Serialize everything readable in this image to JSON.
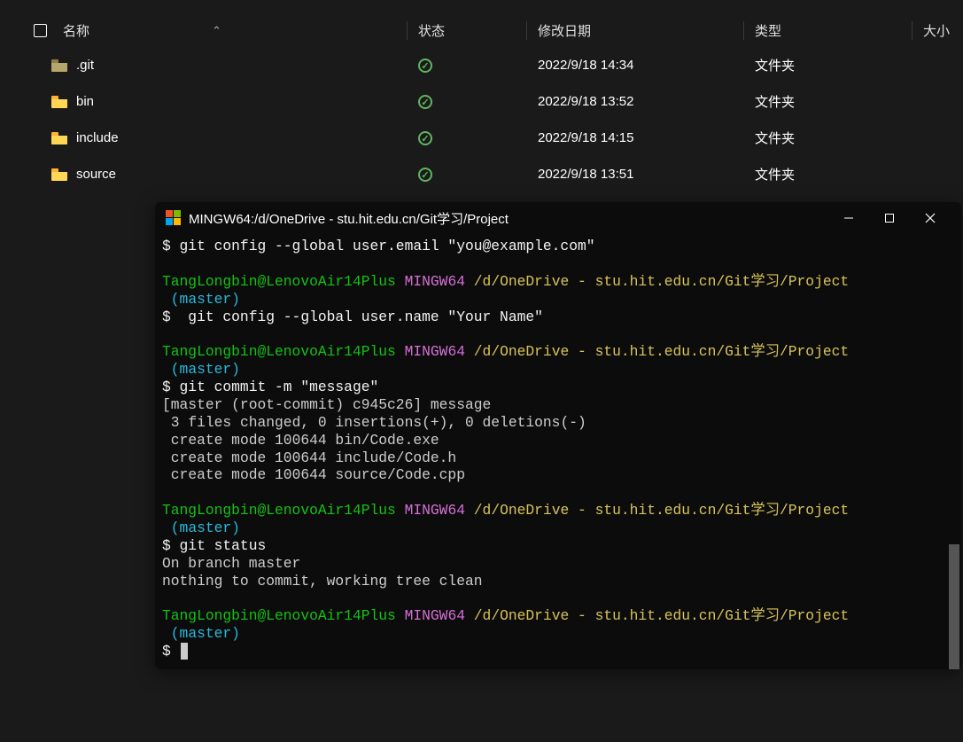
{
  "fileExplorer": {
    "headers": {
      "name": "名称",
      "status": "状态",
      "date": "修改日期",
      "type": "类型",
      "size": "大小"
    },
    "rows": [
      {
        "name": ".git",
        "folderClass": "dark",
        "date": "2022/9/18 14:34",
        "type": "文件夹",
        "hasStatus": true
      },
      {
        "name": "bin",
        "folderClass": "yellow",
        "date": "2022/9/18 13:52",
        "type": "文件夹",
        "hasStatus": true
      },
      {
        "name": "include",
        "folderClass": "yellow",
        "date": "2022/9/18 14:15",
        "type": "文件夹",
        "hasStatus": true
      },
      {
        "name": "source",
        "folderClass": "yellow",
        "date": "2022/9/18 13:51",
        "type": "文件夹",
        "hasStatus": true
      }
    ]
  },
  "terminal": {
    "title": "MINGW64:/d/OneDrive - stu.hit.edu.cn/Git学习/Project",
    "prompt": {
      "user": "TangLongbin@LenovoAir14Plus",
      "env": "MINGW64",
      "path": "/d/OneDrive - stu.hit.edu.cn/Git学习/Project",
      "branch": "(master)"
    },
    "lines": {
      "cmd1": "$ git config --global user.email \"you@example.com\"",
      "cmd2": "$  git config --global user.name \"Your Name\"",
      "cmd3": "$ git commit -m \"message\"",
      "out3a": "[master (root-commit) c945c26] message",
      "out3b": " 3 files changed, 0 insertions(+), 0 deletions(-)",
      "out3c": " create mode 100644 bin/Code.exe",
      "out3d": " create mode 100644 include/Code.h",
      "out3e": " create mode 100644 source/Code.cpp",
      "cmd4": "$ git status",
      "out4a": "On branch master",
      "out4b": "nothing to commit, working tree clean",
      "cmd5": "$ "
    }
  }
}
